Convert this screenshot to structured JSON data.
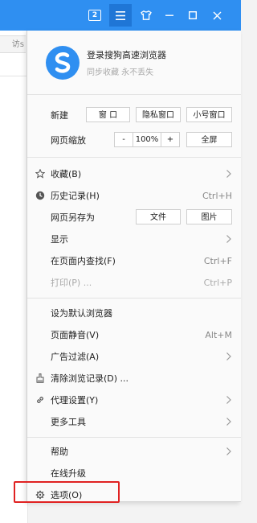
{
  "titlebar": {
    "tab_count": "2",
    "icons": [
      "tab-count-icon",
      "menu-icon",
      "skin-icon",
      "minimize-icon",
      "maximize-icon",
      "close-icon"
    ]
  },
  "background": {
    "address_text": "访s"
  },
  "user": {
    "title": "登录搜狗高速浏览器",
    "subtitle": "同步收藏 永不丢失"
  },
  "new_row": {
    "label": "新建",
    "window": "窗 口",
    "private": "隐私窗口",
    "mini": "小号窗口"
  },
  "zoom_row": {
    "label": "网页缩放",
    "minus": "-",
    "value": "100%",
    "plus": "+",
    "fullscreen": "全屏"
  },
  "items": {
    "favorites": {
      "label": "收藏(B)"
    },
    "history": {
      "label": "历史记录(H)",
      "shortcut": "Ctrl+H"
    },
    "saveas": {
      "label": "网页另存为",
      "file": "文件",
      "image": "图片"
    },
    "display": {
      "label": "显示"
    },
    "find": {
      "label": "在页面内查找(F)",
      "shortcut": "Ctrl+F"
    },
    "print": {
      "label": "打印(P) ...",
      "shortcut": "Ctrl+P"
    },
    "default_browser": {
      "label": "设为默认浏览器"
    },
    "mute": {
      "label": "页面静音(V)",
      "shortcut": "Alt+M"
    },
    "adblock": {
      "label": "广告过滤(A)"
    },
    "clear": {
      "label": "清除浏览记录(D) ..."
    },
    "proxy": {
      "label": "代理设置(Y)"
    },
    "more_tools": {
      "label": "更多工具"
    },
    "help": {
      "label": "帮助"
    },
    "upgrade": {
      "label": "在线升级"
    },
    "options": {
      "label": "选项(O)"
    }
  },
  "colors": {
    "titlebar": "#2f8ff1",
    "highlight": "#e02222",
    "logo": "#2f8ff1"
  }
}
